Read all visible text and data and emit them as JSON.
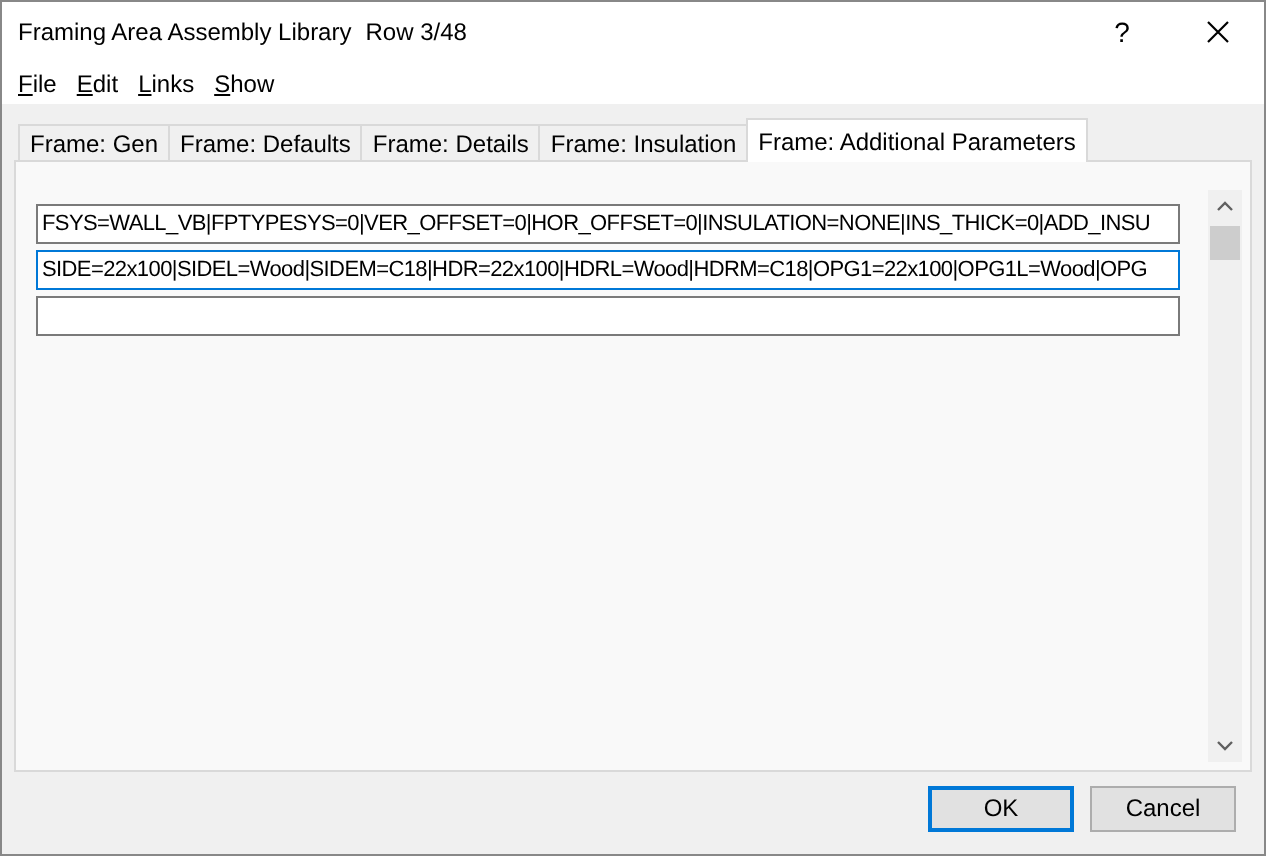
{
  "window": {
    "title": "Framing Area Assembly Library",
    "row_info": "Row 3/48",
    "help_button": "?"
  },
  "menu": [
    "File",
    "Edit",
    "Links",
    "Show"
  ],
  "tabs": [
    {
      "label": "Frame: Gen",
      "selected": false
    },
    {
      "label": "Frame: Defaults",
      "selected": false
    },
    {
      "label": "Frame: Details",
      "selected": false
    },
    {
      "label": "Frame: Insulation",
      "selected": false
    },
    {
      "label": "Frame: Additional Parameters",
      "selected": true
    }
  ],
  "fields": [
    {
      "value": "FSYS=WALL_VB|FPTYPESYS=0|VER_OFFSET=0|HOR_OFFSET=0|INSULATION=NONE|INS_THICK=0|ADD_INSU",
      "focused": false
    },
    {
      "value": "SIDE=22x100|SIDEL=Wood|SIDEM=C18|HDR=22x100|HDRL=Wood|HDRM=C18|OPG1=22x100|OPG1L=Wood|OPG",
      "focused": true
    },
    {
      "focused": false
    }
  ],
  "buttons": [
    {
      "label": "OK",
      "default": true
    },
    {
      "label": "Cancel",
      "default": false
    }
  ]
}
